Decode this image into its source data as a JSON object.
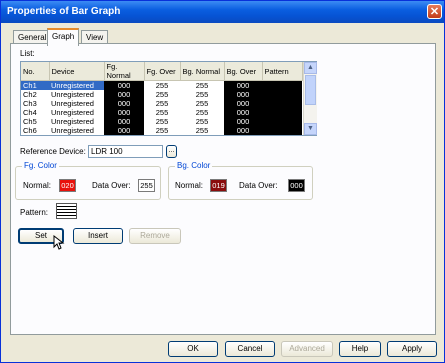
{
  "window": {
    "title": "Properties of Bar Graph",
    "close_symbol": "✕"
  },
  "tabs": [
    {
      "label": "General",
      "active": false
    },
    {
      "label": "Graph",
      "active": true
    },
    {
      "label": "View",
      "active": false
    }
  ],
  "list": {
    "label": "List:",
    "columns": [
      "No.",
      "Device",
      "Fg. Normal",
      "Fg. Over",
      "Bg. Normal",
      "Bg. Over",
      "Pattern"
    ],
    "rows": [
      {
        "no": "Ch1",
        "device": "Unregistered",
        "fg_normal": "000",
        "fg_over": "255",
        "bg_normal": "255",
        "bg_over": "000"
      },
      {
        "no": "Ch2",
        "device": "Unregistered",
        "fg_normal": "000",
        "fg_over": "255",
        "bg_normal": "255",
        "bg_over": "000"
      },
      {
        "no": "Ch3",
        "device": "Unregistered",
        "fg_normal": "000",
        "fg_over": "255",
        "bg_normal": "255",
        "bg_over": "000"
      },
      {
        "no": "Ch4",
        "device": "Unregistered",
        "fg_normal": "000",
        "fg_over": "255",
        "bg_normal": "255",
        "bg_over": "000"
      },
      {
        "no": "Ch5",
        "device": "Unregistered",
        "fg_normal": "000",
        "fg_over": "255",
        "bg_normal": "255",
        "bg_over": "000"
      },
      {
        "no": "Ch6",
        "device": "Unregistered",
        "fg_normal": "000",
        "fg_over": "255",
        "bg_normal": "255",
        "bg_over": "000"
      }
    ],
    "scroll_up": "▲",
    "scroll_down": "▼"
  },
  "reference": {
    "label": "Reference Device:",
    "value": "LDR 100",
    "browse_label": "..."
  },
  "fg_color": {
    "title": "Fg. Color",
    "normal_label": "Normal:",
    "normal_value": "020",
    "normal_color": "#e8120c",
    "over_label": "Data Over:",
    "over_value": "255",
    "over_color": "#ffffff"
  },
  "bg_color": {
    "title": "Bg. Color",
    "normal_label": "Normal:",
    "normal_value": "019",
    "normal_color": "#8a0d0d",
    "over_label": "Data Over:",
    "over_value": "000",
    "over_color": "#000000"
  },
  "pattern": {
    "label": "Pattern:"
  },
  "actions": {
    "set": "Set",
    "insert": "Insert",
    "remove": "Remove"
  },
  "footer": {
    "ok": "OK",
    "cancel": "Cancel",
    "advanced": "Advanced",
    "help": "Help",
    "apply": "Apply"
  }
}
